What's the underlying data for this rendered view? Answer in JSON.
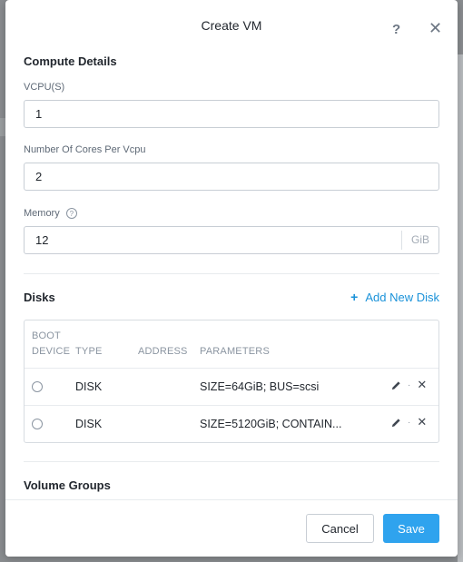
{
  "dialog": {
    "title": "Create VM",
    "help_glyph": "?",
    "close_glyph": "✕"
  },
  "compute": {
    "section_title": "Compute Details",
    "vcpus": {
      "label": "VCPU(S)",
      "value": "1"
    },
    "cores": {
      "label": "Number Of Cores Per Vcpu",
      "value": "2"
    },
    "memory": {
      "label": "Memory",
      "help_glyph": "?",
      "value": "12",
      "unit": "GiB"
    }
  },
  "disks": {
    "section_title": "Disks",
    "add_label": "Add New Disk",
    "add_glyph": "+",
    "columns": {
      "boot_line1": "BOOT",
      "boot_line2": "DEVICE",
      "type": "TYPE",
      "address": "ADDRESS",
      "parameters": "PARAMETERS"
    },
    "rows": [
      {
        "type": "DISK",
        "address": "",
        "parameters": "SIZE=64GiB; BUS=scsi",
        "sep": "·",
        "remove_glyph": "✕"
      },
      {
        "type": "DISK",
        "address": "",
        "parameters": "SIZE=5120GiB; CONTAIN...",
        "sep": "·",
        "remove_glyph": "✕"
      }
    ]
  },
  "volume_groups": {
    "section_title": "Volume Groups"
  },
  "footer": {
    "cancel_label": "Cancel",
    "save_label": "Save"
  },
  "colors": {
    "accent": "#2fa3ee",
    "link": "#1a92d9",
    "text": "#22272e",
    "muted": "#8b95a1"
  },
  "icons": [
    "help-icon",
    "close-icon",
    "plus-icon",
    "edit-pencil-icon",
    "remove-icon",
    "radio-button"
  ]
}
